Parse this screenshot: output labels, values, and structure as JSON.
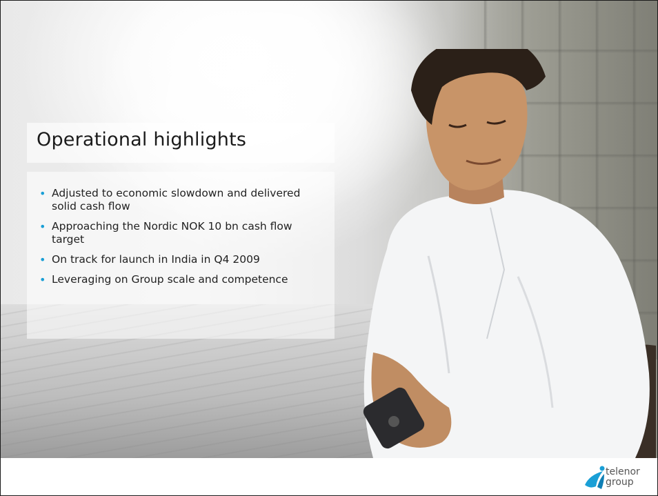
{
  "slide": {
    "title": "Operational highlights",
    "bullets": [
      {
        "text": "Adjusted to economic slowdown and delivered solid cash flow"
      },
      {
        "text": "Approaching the Nordic NOK 10 bn cash flow target"
      },
      {
        "text": "On track for launch in India in Q4 2009"
      },
      {
        "text": "Leveraging on Group scale and competence"
      }
    ],
    "bullet_color": "#1a9fd6"
  },
  "logo": {
    "line1": "telenor",
    "line2": "group",
    "icon": "telenor-propeller-icon",
    "color": "#1a9fd6"
  }
}
